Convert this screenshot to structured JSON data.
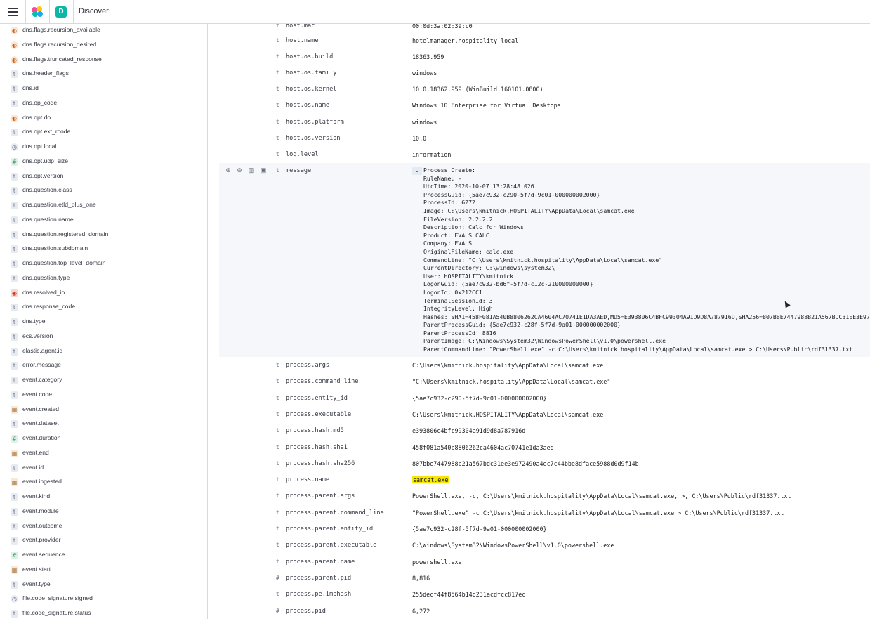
{
  "header": {
    "app_title": "Discover",
    "space_initial": "D"
  },
  "sidebar": {
    "fields": [
      {
        "type": "boolean",
        "name": "dns.flags.recursion_available"
      },
      {
        "type": "boolean",
        "name": "dns.flags.recursion_desired"
      },
      {
        "type": "boolean",
        "name": "dns.flags.truncated_response"
      },
      {
        "type": "string",
        "name": "dns.header_flags"
      },
      {
        "type": "string",
        "name": "dns.id"
      },
      {
        "type": "string",
        "name": "dns.op_code"
      },
      {
        "type": "boolean",
        "name": "dns.opt.do"
      },
      {
        "type": "string",
        "name": "dns.opt.ext_rcode"
      },
      {
        "type": "geo",
        "name": "dns.opt.local"
      },
      {
        "type": "number",
        "name": "dns.opt.udp_size"
      },
      {
        "type": "string",
        "name": "dns.opt.version"
      },
      {
        "type": "string",
        "name": "dns.question.class"
      },
      {
        "type": "string",
        "name": "dns.question.etld_plus_one"
      },
      {
        "type": "string",
        "name": "dns.question.name"
      },
      {
        "type": "string",
        "name": "dns.question.registered_domain"
      },
      {
        "type": "string",
        "name": "dns.question.subdomain"
      },
      {
        "type": "string",
        "name": "dns.question.top_level_domain"
      },
      {
        "type": "string",
        "name": "dns.question.type"
      },
      {
        "type": "ip",
        "name": "dns.resolved_ip"
      },
      {
        "type": "string",
        "name": "dns.response_code"
      },
      {
        "type": "string",
        "name": "dns.type"
      },
      {
        "type": "string",
        "name": "ecs.version"
      },
      {
        "type": "string",
        "name": "elastic.agent.id"
      },
      {
        "type": "string",
        "name": "error.message"
      },
      {
        "type": "string",
        "name": "event.category"
      },
      {
        "type": "string",
        "name": "event.code"
      },
      {
        "type": "date",
        "name": "event.created"
      },
      {
        "type": "string",
        "name": "event.dataset"
      },
      {
        "type": "number",
        "name": "event.duration"
      },
      {
        "type": "date",
        "name": "event.end"
      },
      {
        "type": "string",
        "name": "event.id"
      },
      {
        "type": "date",
        "name": "event.ingested"
      },
      {
        "type": "string",
        "name": "event.kind"
      },
      {
        "type": "string",
        "name": "event.module"
      },
      {
        "type": "string",
        "name": "event.outcome"
      },
      {
        "type": "string",
        "name": "event.provider"
      },
      {
        "type": "number",
        "name": "event.sequence"
      },
      {
        "type": "date",
        "name": "event.start"
      },
      {
        "type": "string",
        "name": "event.type"
      },
      {
        "type": "geo",
        "name": "file.code_signature.signed"
      },
      {
        "type": "string",
        "name": "file.code_signature.status"
      }
    ]
  },
  "doc": {
    "top_rows": [
      {
        "t": "t",
        "key": "host.mac",
        "value": "00:0d:3a:02:39:c0"
      },
      {
        "t": "t",
        "key": "host.name",
        "value": "hotelmanager.hospitality.local"
      },
      {
        "t": "t",
        "key": "host.os.build",
        "value": "18363.959"
      },
      {
        "t": "t",
        "key": "host.os.family",
        "value": "windows"
      },
      {
        "t": "t",
        "key": "host.os.kernel",
        "value": "10.0.18362.959 (WinBuild.160101.0800)"
      },
      {
        "t": "t",
        "key": "host.os.name",
        "value": "Windows 10 Enterprise for Virtual Desktops"
      },
      {
        "t": "t",
        "key": "host.os.platform",
        "value": "windows"
      },
      {
        "t": "t",
        "key": "host.os.version",
        "value": "10.0"
      },
      {
        "t": "t",
        "key": "log.level",
        "value": "information"
      }
    ],
    "message": {
      "type": "t",
      "key": "message",
      "lines": [
        "Process Create:",
        "RuleName: -",
        "UtcTime: 2020-10-07 13:28:48.026",
        "ProcessGuid: {5ae7c932-c290-5f7d-9c01-000000002000}",
        "ProcessId: 6272",
        "Image: C:\\Users\\kmitnick.HOSPITALITY\\AppData\\Local\\samcat.exe",
        "FileVersion: 2.2.2.2",
        "Description: Calc for Windows",
        "Product: EVALS CALC",
        "Company: EVALS",
        "OriginalFileName: calc.exe",
        "CommandLine: \"C:\\Users\\kmitnick.hospitality\\AppData\\Local\\samcat.exe\"",
        "CurrentDirectory: C:\\windows\\system32\\",
        "User: HOSPITALITY\\kmitnick",
        "LogonGuid: {5ae7c932-bd6f-5f7d-c12c-210000000000}",
        "LogonId: 0x212CC1",
        "TerminalSessionId: 3",
        "IntegrityLevel: High",
        "Hashes: SHA1=458F081A540B8806262CA4604AC70741E1DA3AED,MD5=E393806C4BFC99304A91D9D8A787916D,SHA256=807BBE7447988B21A567BDC31EE3E97",
        "ParentProcessGuid: {5ae7c932-c28f-5f7d-9a01-000000002000}",
        "ParentProcessId: 8816",
        "ParentImage: C:\\Windows\\System32\\WindowsPowerShell\\v1.0\\powershell.exe",
        "ParentCommandLine: \"PowerShell.exe\" -c C:\\Users\\kmitnick.hospitality\\AppData\\Local\\samcat.exe > C:\\Users\\Public\\rdf31337.txt"
      ]
    },
    "bottom_rows": [
      {
        "t": "t",
        "key": "process.args",
        "value": "C:\\Users\\kmitnick.hospitality\\AppData\\Local\\samcat.exe"
      },
      {
        "t": "t",
        "key": "process.command_line",
        "value": "\"C:\\Users\\kmitnick.hospitality\\AppData\\Local\\samcat.exe\""
      },
      {
        "t": "t",
        "key": "process.entity_id",
        "value": "{5ae7c932-c290-5f7d-9c01-000000002000}"
      },
      {
        "t": "t",
        "key": "process.executable",
        "value": "C:\\Users\\kmitnick.HOSPITALITY\\AppData\\Local\\samcat.exe"
      },
      {
        "t": "t",
        "key": "process.hash.md5",
        "value": "e393806c4bfc99304a91d9d8a787916d"
      },
      {
        "t": "t",
        "key": "process.hash.sha1",
        "value": "458f081a540b8806262ca4604ac70741e1da3aed"
      },
      {
        "t": "t",
        "key": "process.hash.sha256",
        "value": "807bbe7447988b21a567bdc31ee3e972490a4ec7c44bbe8dface5988d0d9f14b"
      },
      {
        "t": "t",
        "key": "process.name",
        "value": "samcat.exe",
        "highlight": true
      },
      {
        "t": "t",
        "key": "process.parent.args",
        "value": "PowerShell.exe, -c, C:\\Users\\kmitnick.hospitality\\AppData\\Local\\samcat.exe, >, C:\\Users\\Public\\rdf31337.txt"
      },
      {
        "t": "t",
        "key": "process.parent.command_line",
        "value": "\"PowerShell.exe\" -c C:\\Users\\kmitnick.hospitality\\AppData\\Local\\samcat.exe > C:\\Users\\Public\\rdf31337.txt"
      },
      {
        "t": "t",
        "key": "process.parent.entity_id",
        "value": "{5ae7c932-c28f-5f7d-9a01-000000002000}"
      },
      {
        "t": "t",
        "key": "process.parent.executable",
        "value": "C:\\Windows\\System32\\WindowsPowerShell\\v1.0\\powershell.exe"
      },
      {
        "t": "t",
        "key": "process.parent.name",
        "value": "powershell.exe"
      },
      {
        "t": "#",
        "key": "process.parent.pid",
        "value": "8,816"
      },
      {
        "t": "t",
        "key": "process.pe.imphash",
        "value": "255decf44f8564b14d231acdfcc817ec"
      },
      {
        "t": "#",
        "key": "process.pid",
        "value": "6,272"
      }
    ]
  }
}
